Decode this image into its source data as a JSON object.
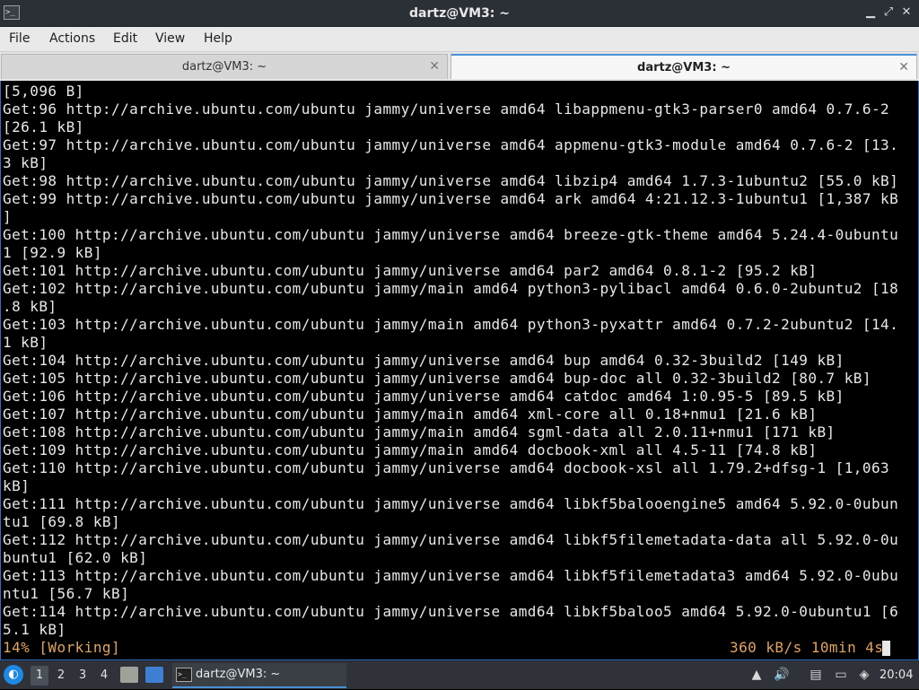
{
  "window": {
    "title": "dartz@VM3: ~",
    "minimize_glyph": "▁",
    "maximize_glyph": "⤢",
    "close_glyph": "✕",
    "app_icon_glyph": ">_"
  },
  "menubar": {
    "items": [
      "File",
      "Actions",
      "Edit",
      "View",
      "Help"
    ]
  },
  "tabs": [
    {
      "label": "dartz@VM3: ~",
      "active": false,
      "close_glyph": "✕"
    },
    {
      "label": "dartz@VM3: ~",
      "active": true,
      "close_glyph": "✕"
    }
  ],
  "terminal": {
    "lines": [
      "[5,096 B]",
      "Get:96 http://archive.ubuntu.com/ubuntu jammy/universe amd64 libappmenu-gtk3-parser0 amd64 0.7.6-2",
      "[26.1 kB]",
      "Get:97 http://archive.ubuntu.com/ubuntu jammy/universe amd64 appmenu-gtk3-module amd64 0.7.6-2 [13.",
      "3 kB]",
      "Get:98 http://archive.ubuntu.com/ubuntu jammy/universe amd64 libzip4 amd64 1.7.3-1ubuntu2 [55.0 kB]",
      "Get:99 http://archive.ubuntu.com/ubuntu jammy/universe amd64 ark amd64 4:21.12.3-1ubuntu1 [1,387 kB",
      "]",
      "Get:100 http://archive.ubuntu.com/ubuntu jammy/universe amd64 breeze-gtk-theme amd64 5.24.4-0ubuntu",
      "1 [92.9 kB]",
      "Get:101 http://archive.ubuntu.com/ubuntu jammy/universe amd64 par2 amd64 0.8.1-2 [95.2 kB]",
      "Get:102 http://archive.ubuntu.com/ubuntu jammy/main amd64 python3-pylibacl amd64 0.6.0-2ubuntu2 [18",
      ".8 kB]",
      "Get:103 http://archive.ubuntu.com/ubuntu jammy/main amd64 python3-pyxattr amd64 0.7.2-2ubuntu2 [14.",
      "1 kB]",
      "Get:104 http://archive.ubuntu.com/ubuntu jammy/universe amd64 bup amd64 0.32-3build2 [149 kB]",
      "Get:105 http://archive.ubuntu.com/ubuntu jammy/universe amd64 bup-doc all 0.32-3build2 [80.7 kB]",
      "Get:106 http://archive.ubuntu.com/ubuntu jammy/universe amd64 catdoc amd64 1:0.95-5 [89.5 kB]",
      "Get:107 http://archive.ubuntu.com/ubuntu jammy/main amd64 xml-core all 0.18+nmu1 [21.6 kB]",
      "Get:108 http://archive.ubuntu.com/ubuntu jammy/main amd64 sgml-data all 2.0.11+nmu1 [171 kB]",
      "Get:109 http://archive.ubuntu.com/ubuntu jammy/main amd64 docbook-xml all 4.5-11 [74.8 kB]",
      "Get:110 http://archive.ubuntu.com/ubuntu jammy/universe amd64 docbook-xsl all 1.79.2+dfsg-1 [1,063",
      "kB]",
      "Get:111 http://archive.ubuntu.com/ubuntu jammy/universe amd64 libkf5balooengine5 amd64 5.92.0-0ubun",
      "tu1 [69.8 kB]",
      "Get:112 http://archive.ubuntu.com/ubuntu jammy/universe amd64 libkf5filemetadata-data all 5.92.0-0u",
      "buntu1 [62.0 kB]",
      "Get:113 http://archive.ubuntu.com/ubuntu jammy/universe amd64 libkf5filemetadata3 amd64 5.92.0-0ubu",
      "ntu1 [56.7 kB]",
      "Get:114 http://archive.ubuntu.com/ubuntu jammy/universe amd64 libkf5baloo5 amd64 5.92.0-0ubuntu1 [6",
      "5.1 kB]"
    ],
    "status_left": "14% [Working]",
    "status_right": "360 kB/s 10min 4s",
    "colors": {
      "background": "#000000",
      "text": "#e8e8e8",
      "status": "#e2a35b"
    }
  },
  "taskbar": {
    "workspaces": [
      "1",
      "2",
      "3",
      "4"
    ],
    "active_workspace": "1",
    "task_label": "dartz@VM3: ~",
    "clock": "20:04",
    "accent": "#4a90d9"
  }
}
